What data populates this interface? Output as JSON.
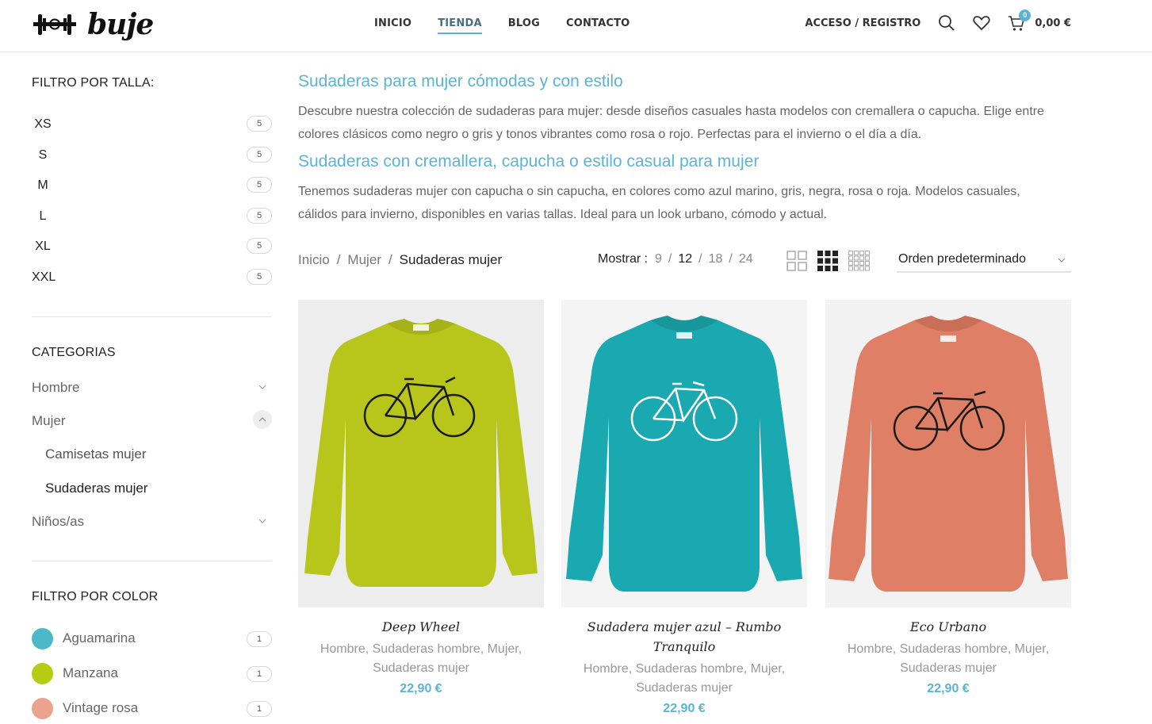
{
  "header": {
    "logo_text": "buje",
    "nav": [
      "INICIO",
      "TIENDA",
      "BLOG",
      "CONTACTO"
    ],
    "active_nav": "TIENDA",
    "login_label": "ACCESO / REGISTRO",
    "cart_count": "0",
    "cart_total": "0,00 €",
    "accent_color": "#5bb4d6"
  },
  "sidebar": {
    "size_filter_title": "FILTRO POR TALLA:",
    "sizes": [
      {
        "label": "XS",
        "count": "5"
      },
      {
        "label": "S",
        "count": "5"
      },
      {
        "label": "M",
        "count": "5"
      },
      {
        "label": "L",
        "count": "5"
      },
      {
        "label": "XL",
        "count": "5"
      },
      {
        "label": "XXL",
        "count": "5"
      }
    ],
    "categories_title": "CATEGORIAS",
    "categories": [
      {
        "label": "Hombre"
      },
      {
        "label": "Mujer"
      },
      {
        "label": "Camisetas mujer"
      },
      {
        "label": "Sudaderas mujer"
      },
      {
        "label": "Niños/as"
      }
    ],
    "color_filter_title": "FILTRO POR COLOR",
    "colors": [
      {
        "label": "Aguamarina",
        "count": "1",
        "swatch": "#4db8c8"
      },
      {
        "label": "Manzana",
        "count": "1",
        "swatch": "#b5cc12"
      },
      {
        "label": "Vintage rosa",
        "count": "1",
        "swatch": "#eba390"
      }
    ]
  },
  "main": {
    "heading1": "Sudaderas para mujer cómodas y con estilo",
    "para1_line1": "Descubre nuestra colección de sudaderas para mujer: desde diseños casuales hasta modelos con cremallera o capucha. Elige entre",
    "para1_line2": "colores clásicos como negro o gris y tonos vibrantes como rosa o rojo. Perfectas para el invierno o el día a día.",
    "heading2": "Sudaderas con cremallera, capucha o estilo casual para mujer",
    "para2_line1": "Tenemos sudaderas mujer con capucha o sin capucha, en colores como azul marino, gris, negra, rosa o roja. Modelos casuales,",
    "para2_line2": "cálidos para invierno, disponibles en varias tallas. Ideal para un look urbano, cómodo y actual.",
    "breadcrumb": [
      "Inicio",
      "Mujer",
      "Sudaderas mujer"
    ],
    "breadcrumb_sep": "/",
    "show_label": "Mostrar :",
    "show_options": [
      "9",
      "12",
      "18",
      "24"
    ],
    "show_selected": "12",
    "order_label": "Orden predeterminado"
  },
  "products": [
    {
      "title": "Deep Wheel",
      "cats_line1": "Hombre, Sudaderas hombre, Mujer,",
      "cats_line2": "Sudaderas mujer",
      "price": "22,90 €",
      "color": "#b8c51b",
      "print": "#1a1a1a"
    },
    {
      "title_line1": "Sudadera mujer azul – Rumbo",
      "title_line2": "Tranquilo",
      "cats_line1": "Hombre, Sudaderas hombre, Mujer,",
      "cats_line2": "Sudaderas mujer",
      "price": "22,90 €",
      "color": "#1aa9b0",
      "print": "#ffffff"
    },
    {
      "title": "Eco Urbano",
      "cats_line1": "Hombre, Sudaderas hombre, Mujer,",
      "cats_line2": "Sudaderas mujer",
      "price": "22,90 €",
      "color": "#df7f66",
      "print": "#1a1a1a"
    }
  ]
}
